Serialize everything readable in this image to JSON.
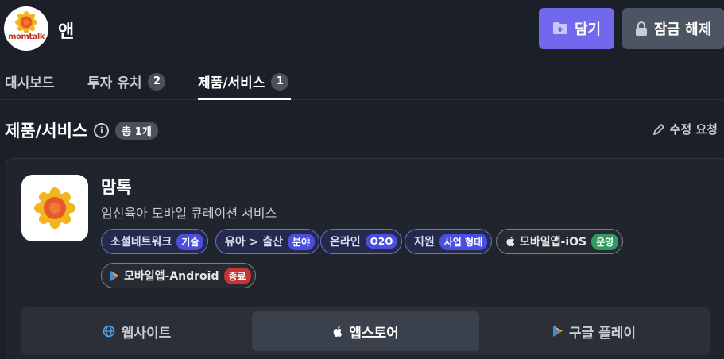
{
  "header": {
    "company_name": "앤",
    "logo_text": "momtalk",
    "save_label": "담기",
    "unlock_label": "잠금 해제"
  },
  "tabs": [
    {
      "label": "대시보드",
      "count": null
    },
    {
      "label": "투자 유치",
      "count": "2"
    },
    {
      "label": "제품/서비스",
      "count": "1",
      "active": true
    }
  ],
  "section": {
    "title": "제품/서비스",
    "info_icon": "info-icon",
    "total": "총 1개",
    "edit_label": "수정 요청"
  },
  "product": {
    "name": "맘톡",
    "description": "임신육아 모바일 큐레이션 서비스",
    "chips": [
      {
        "label": "소셜네트워크",
        "sub": "기술"
      },
      {
        "label": "유아 > 출산",
        "sub": "분야"
      },
      {
        "label": "온라인",
        "sub": "O2O"
      },
      {
        "label": "지원",
        "sub": "사업 형태"
      },
      {
        "label": "모바일앱-iOS",
        "sub": "운영"
      },
      {
        "label": "모바일앱-Android",
        "sub": "종료"
      }
    ]
  },
  "links": [
    {
      "label": "웹사이트",
      "icon": "globe-icon"
    },
    {
      "label": "앱스토어",
      "icon": "apple-icon",
      "active": true
    },
    {
      "label": "구글 플레이",
      "icon": "google-play-icon"
    }
  ],
  "colors": {
    "background": "#1b1f27",
    "accent": "#7168ee",
    "chip_purple_border": "#6d6fd8",
    "status_green": "#2f9b5c",
    "status_red": "#c83333"
  }
}
